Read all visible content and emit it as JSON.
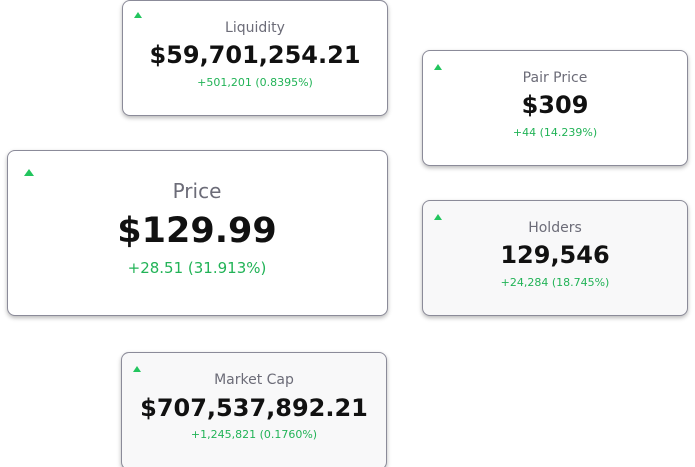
{
  "cards": {
    "liquidity": {
      "label": "Liquidity",
      "value": "$59,701,254.21",
      "change": "+501,201 (0.8395%)",
      "trend": "up"
    },
    "pair_price": {
      "label": "Pair Price",
      "value": "$309",
      "change": "+44 (14.239%)",
      "trend": "up"
    },
    "price": {
      "label": "Price",
      "value": "$129.99",
      "change": "+28.51 (31.913%)",
      "trend": "up"
    },
    "holders": {
      "label": "Holders",
      "value": "129,546",
      "change": "+24,284 (18.745%)",
      "trend": "up"
    },
    "market_cap": {
      "label": "Market Cap",
      "value": "$707,537,892.21",
      "change": "+1,245,821 (0.1760%)",
      "trend": "up"
    }
  },
  "colors": {
    "positive": "#22b357",
    "trend_up_icon": "#22c55e",
    "label": "#6c6c78",
    "value": "#111111",
    "card_border": "#8b8b99"
  },
  "icons": {
    "trend_up": "triangle-up-icon"
  }
}
